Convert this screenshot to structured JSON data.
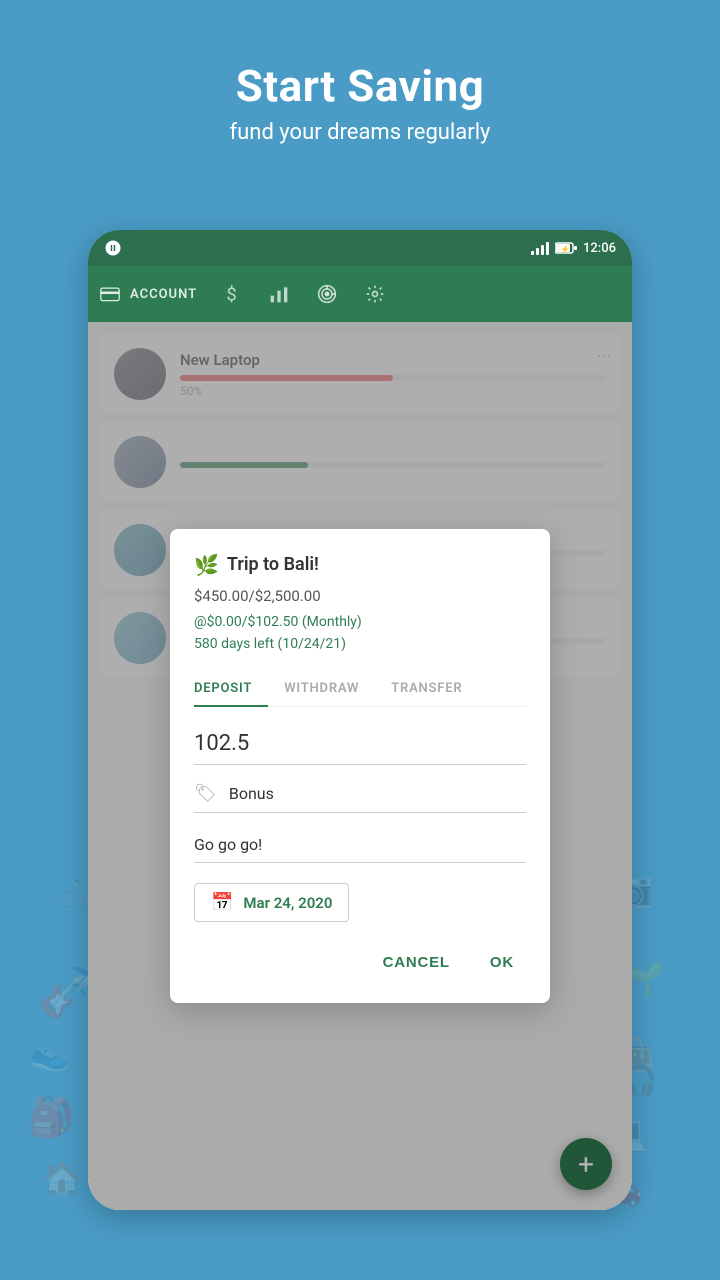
{
  "page": {
    "bg_color": "#4a9cc7",
    "title": "Start Saving",
    "subtitle": "fund your dreams regularly"
  },
  "status_bar": {
    "time": "12:06"
  },
  "toolbar": {
    "items": [
      {
        "label": "ACCOUNT",
        "icon": "card"
      },
      {
        "label": "",
        "icon": "dollar"
      },
      {
        "label": "",
        "icon": "chart"
      },
      {
        "label": "",
        "icon": "target"
      },
      {
        "label": "",
        "icon": "gear"
      }
    ]
  },
  "list_items": [
    {
      "name": "New Laptop",
      "progress": 50,
      "percent_label": "50%"
    },
    {
      "name": "",
      "progress": 30,
      "percent_label": ""
    },
    {
      "name": "",
      "progress": 60,
      "percent_label": ""
    },
    {
      "name": "",
      "progress": 40,
      "percent_label": ""
    }
  ],
  "dialog": {
    "emoji": "🌿",
    "title": "Trip to Bali!",
    "amount_current": "$450.00",
    "amount_goal": "$2,500.00",
    "amount_display": "$450.00/$2,500.00",
    "monthly_info": "@$0.00/$102.50 (Monthly)",
    "days_left": "580 days left (10/24/21)",
    "tabs": [
      {
        "label": "DEPOSIT",
        "active": true
      },
      {
        "label": "WITHDRAW",
        "active": false
      },
      {
        "label": "TRANSFER",
        "active": false
      }
    ],
    "amount_input": "102.5",
    "category_label": "Bonus",
    "note_input": "Go go go!",
    "date_label": "Mar 24, 2020",
    "cancel_label": "CANCEL",
    "ok_label": "OK"
  },
  "fab": {
    "icon": "+"
  }
}
